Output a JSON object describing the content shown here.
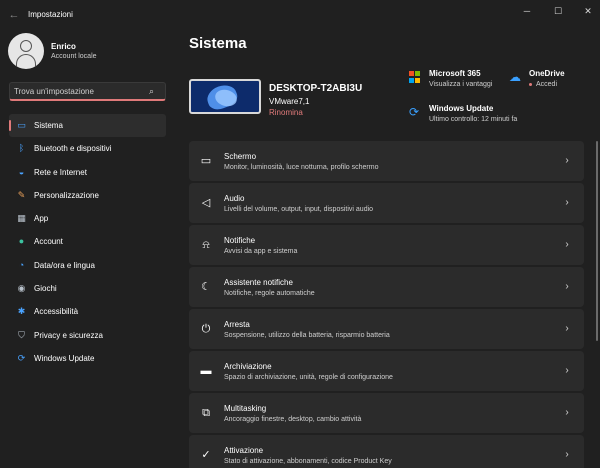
{
  "window": {
    "title": "Impostazioni",
    "back_glyph": "←",
    "controls": {
      "minimize": "─",
      "maximize": "☐",
      "close": "✕"
    }
  },
  "profile": {
    "name": "Enrico",
    "account_type": "Account locale"
  },
  "search": {
    "placeholder": "Trova un'impostazione",
    "icon": "search-icon"
  },
  "sidebar": {
    "items": [
      {
        "label": "Sistema",
        "icon": "system-icon",
        "glyph": "▭",
        "color": "#4aa3ff",
        "active": true
      },
      {
        "label": "Bluetooth e dispositivi",
        "icon": "bluetooth-icon",
        "glyph": "ᛒ",
        "color": "#4aa3ff",
        "active": false
      },
      {
        "label": "Rete e Internet",
        "icon": "wifi-icon",
        "glyph": "◒",
        "color": "#4aa3ff",
        "active": false
      },
      {
        "label": "Personalizzazione",
        "icon": "brush-icon",
        "glyph": "✎",
        "color": "#e8a05a",
        "active": false
      },
      {
        "label": "App",
        "icon": "apps-icon",
        "glyph": "▦",
        "color": "#b9c2cc",
        "active": false
      },
      {
        "label": "Account",
        "icon": "account-icon",
        "glyph": "●",
        "color": "#3cc2a0",
        "active": false
      },
      {
        "label": "Data/ora e lingua",
        "icon": "globe-clock-icon",
        "glyph": "◔",
        "color": "#4aa3ff",
        "active": false
      },
      {
        "label": "Giochi",
        "icon": "gamepad-icon",
        "glyph": "◉",
        "color": "#b9c2cc",
        "active": false
      },
      {
        "label": "Accessibilità",
        "icon": "accessibility-icon",
        "glyph": "✱",
        "color": "#4aa3ff",
        "active": false
      },
      {
        "label": "Privacy e sicurezza",
        "icon": "shield-icon",
        "glyph": "⛉",
        "color": "#b9c2cc",
        "active": false
      },
      {
        "label": "Windows Update",
        "icon": "update-icon",
        "glyph": "⟳",
        "color": "#4aa3ff",
        "active": false
      }
    ]
  },
  "main": {
    "page_title": "Sistema",
    "device": {
      "name": "DESKTOP-T2ABI3U",
      "model": "VMware7,1",
      "rename_label": "Rinomina"
    },
    "quick": {
      "ms365": {
        "title": "Microsoft 365",
        "subtitle": "Visualizza i vantaggi"
      },
      "onedrive": {
        "title": "OneDrive",
        "subtitle": "Accedi"
      },
      "update": {
        "title": "Windows Update",
        "subtitle": "Ultimo controllo: 12 minuti fa"
      }
    },
    "ms_logo_colors": [
      "#f25022",
      "#7fba00",
      "#00a4ef",
      "#ffb900"
    ],
    "settings": [
      {
        "title": "Schermo",
        "description": "Monitor, luminosità, luce notturna, profilo schermo",
        "icon": "display-icon",
        "glyph": "▭"
      },
      {
        "title": "Audio",
        "description": "Livelli del volume, output, input, dispositivi audio",
        "icon": "speaker-icon",
        "glyph": "◁"
      },
      {
        "title": "Notifiche",
        "description": "Avvisi da app e sistema",
        "icon": "bell-icon",
        "glyph": "⍾"
      },
      {
        "title": "Assistente notifiche",
        "description": "Notifiche, regole automatiche",
        "icon": "moon-icon",
        "glyph": "☾"
      },
      {
        "title": "Arresta",
        "description": "Sospensione, utilizzo della batteria, risparmio batteria",
        "icon": "power-icon",
        "glyph": "⏻"
      },
      {
        "title": "Archiviazione",
        "description": "Spazio di archiviazione, unità, regole di configurazione",
        "icon": "storage-icon",
        "glyph": "▬"
      },
      {
        "title": "Multitasking",
        "description": "Ancoraggio finestre, desktop, cambio attività",
        "icon": "multitasking-icon",
        "glyph": "⧉"
      },
      {
        "title": "Attivazione",
        "description": "Stato di attivazione, abbonamenti, codice Product Key",
        "icon": "check-circle-icon",
        "glyph": "✓"
      }
    ],
    "chevron_glyph": "›"
  },
  "colors": {
    "background": "#202020",
    "card": "#2b2b2b",
    "accent": "#e07a7a",
    "active_item": "#2d2d2d"
  }
}
